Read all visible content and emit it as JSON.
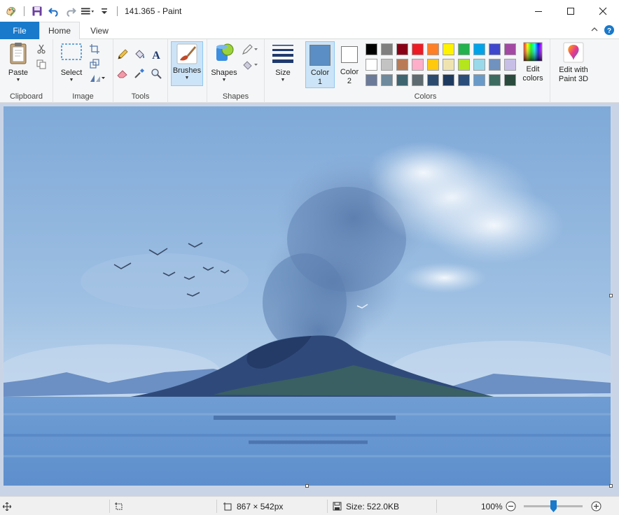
{
  "window": {
    "title": "141.365 - Paint"
  },
  "tabs": {
    "file": "File",
    "home": "Home",
    "view": "View"
  },
  "ribbon": {
    "clipboard": {
      "label": "Clipboard",
      "paste": "Paste"
    },
    "image": {
      "label": "Image",
      "select": "Select"
    },
    "tools": {
      "label": "Tools"
    },
    "brushes": {
      "label": "Brushes"
    },
    "shapes": {
      "label": "Shapes",
      "button": "Shapes"
    },
    "size": {
      "label": "Size"
    },
    "colors": {
      "label": "Colors",
      "color1": "Color\n1",
      "color1_value": "#5b8ec4",
      "color2": "Color\n2",
      "color2_value": "#ffffff",
      "edit_colors": "Edit\ncolors",
      "palette_row1": [
        "#000000",
        "#7f7f7f",
        "#880015",
        "#ed1c24",
        "#ff7f27",
        "#fff200",
        "#22b14c",
        "#00a2e8",
        "#3f48cc",
        "#a349a4"
      ],
      "palette_row2": [
        "#ffffff",
        "#c3c3c3",
        "#b97a57",
        "#ffaec9",
        "#ffc90e",
        "#efe4b0",
        "#b5e61d",
        "#99d9ea",
        "#7092be",
        "#c8bfe7"
      ],
      "palette_row3": [
        "#6b7a99",
        "#6e8a9c",
        "#3e6470",
        "#5e6b70",
        "#2c4a6e",
        "#1f3a5f",
        "#2a4d7a",
        "#6a9ac8",
        "#3e6b60",
        "#2a4a3e"
      ]
    },
    "paint3d": {
      "label": "Edit with\nPaint 3D"
    }
  },
  "status": {
    "dimensions": "867 × 542px",
    "size": "Size: 522.0KB",
    "zoom": "100%"
  }
}
